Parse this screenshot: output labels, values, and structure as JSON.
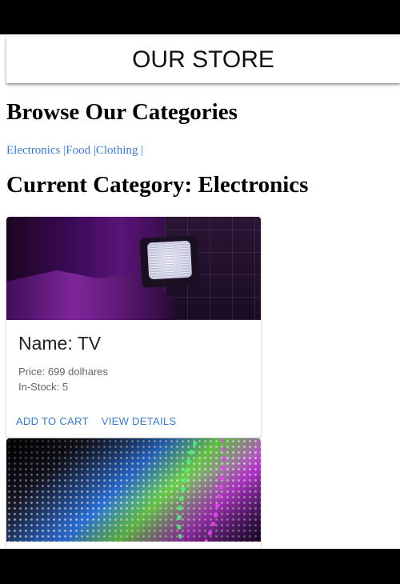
{
  "appbar": {
    "title": "OUR STORE"
  },
  "browse": {
    "heading": "Browse Our Categories",
    "categories": [
      "Electronics",
      "Food",
      "Clothing"
    ],
    "separator": "|"
  },
  "current": {
    "heading": "Current Category: Electronics"
  },
  "products": [
    {
      "name": "Name: TV",
      "price": "Price: 699 dolhares",
      "stock": "In-Stock: 5",
      "add_label": "ADD TO CART",
      "view_label": "VIEW DETAILS",
      "image": "tv-photo"
    },
    {
      "image": "speaker-photo"
    }
  ],
  "colors": {
    "link": "#3b7bc4",
    "chrome": "#000000"
  }
}
